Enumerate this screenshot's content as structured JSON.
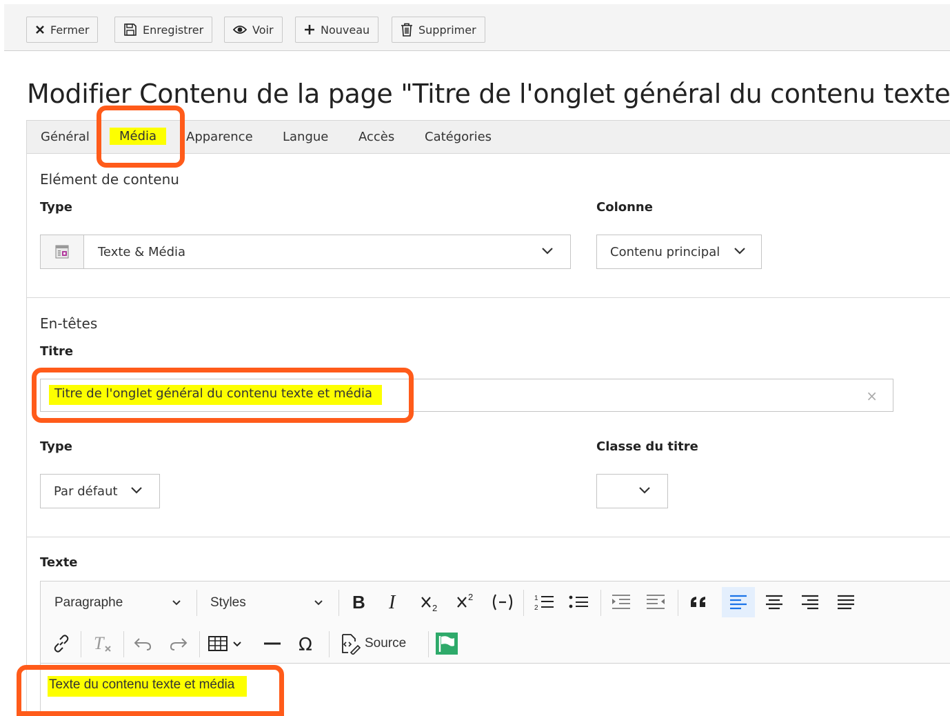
{
  "toolbar": {
    "close_label": "Fermer",
    "save_label": "Enregistrer",
    "view_label": "Voir",
    "new_label": "Nouveau",
    "delete_label": "Supprimer"
  },
  "page_title": "Modifier Contenu de la page \"Titre de l'onglet général du contenu texte et média\"",
  "tabs": [
    {
      "label": "Général",
      "active": true
    },
    {
      "label": "Média"
    },
    {
      "label": "Apparence"
    },
    {
      "label": "Langue"
    },
    {
      "label": "Accès"
    },
    {
      "label": "Catégories"
    }
  ],
  "content_element": {
    "section_title": "Elément de contenu",
    "type_label": "Type",
    "type_value": "Texte & Média",
    "column_label": "Colonne",
    "column_value": "Contenu principal"
  },
  "headers": {
    "section_title": "En-têtes",
    "title_label": "Titre",
    "title_value": "Titre de l'onglet général du contenu texte et média",
    "clear_icon": "×",
    "type_label": "Type",
    "type_value": "Par défaut",
    "class_label": "Classe du titre",
    "class_value": ""
  },
  "text": {
    "label": "Texte",
    "paragraph_select": "Paragraphe",
    "styles_select": "Styles",
    "source_label": "Source",
    "content": "Texte du contenu texte et média"
  },
  "colors": {
    "highlight": "#fdff00",
    "annotation": "#ff5b1a",
    "active_align": "#1a73e8",
    "flag_green": "#2eaa6a"
  }
}
